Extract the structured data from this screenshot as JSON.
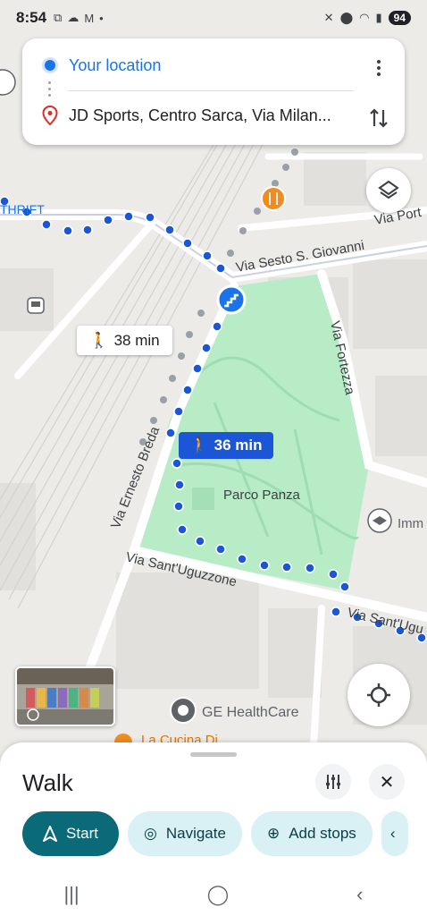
{
  "status_bar": {
    "time": "8:54",
    "battery": "94"
  },
  "directions": {
    "origin": "Your location",
    "destination": "JD Sports, Centro Sarca, Via Milan..."
  },
  "map": {
    "labels": {
      "thrift": "THRIFT",
      "via_port": "Via Port",
      "via_sesto": "Via Sesto S. Giovanni",
      "via_fortezza": "Via Fortezza",
      "via_breda": "Via Ernesto Breda",
      "parco_panza": "Parco Panza",
      "via_sant_uguzzone": "Via Sant'Uguzzone",
      "via_sant_ugu_right": "Via Sant'Ugu",
      "imm": "Imm",
      "ge_healthcare": "GE HealthCare",
      "la_cucina": "La Cucina Di"
    },
    "route_alt_time": "38 min",
    "route_main_time": "36 min"
  },
  "sheet": {
    "title": "Walk",
    "chips": {
      "start": "Start",
      "navigate": "Navigate",
      "add_stops": "Add stops"
    }
  },
  "colors": {
    "route_blue": "#1a56d6",
    "park_green": "#b7ecc7",
    "accent_teal": "#0b6a78"
  }
}
